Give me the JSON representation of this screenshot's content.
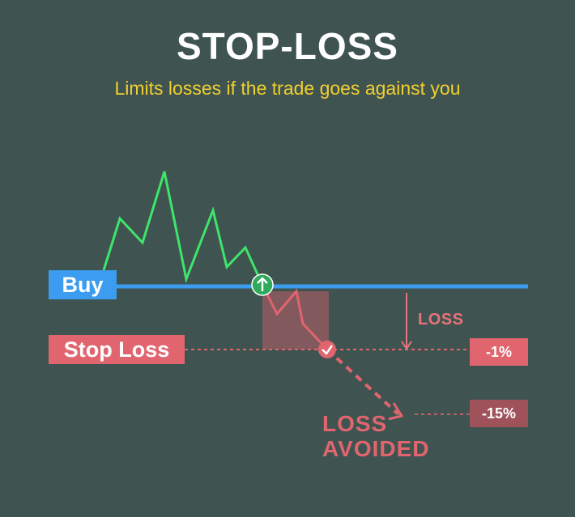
{
  "title": "STOP-LOSS",
  "subtitle": "Limits losses if the trade goes against you",
  "labels": {
    "buy": "Buy",
    "stop_loss": "Stop Loss",
    "loss": "LOSS",
    "loss_avoided_line1": "LOSS",
    "loss_avoided_line2": "AVOIDED",
    "stop_pct": "-1%",
    "avoided_pct": "-15%"
  },
  "colors": {
    "background": "#3f5450",
    "price_up": "#3ee56a",
    "price_down": "#e0656f",
    "buy_line": "#3b9cf0",
    "stop_line": "#e0656f",
    "title": "#ffffff",
    "subtitle": "#f2cf2e"
  },
  "icons": {
    "buy_marker": "arrow-up-icon",
    "stop_marker": "checkmark-icon"
  }
}
